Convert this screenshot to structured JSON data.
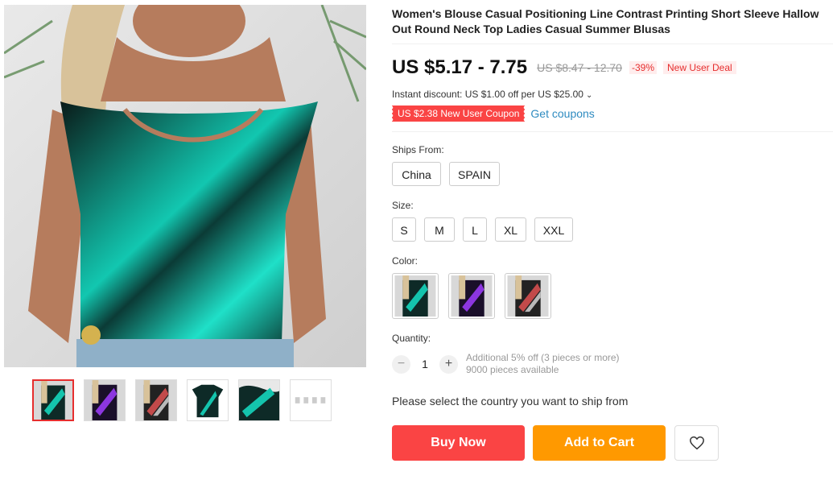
{
  "gallery": {
    "thumbnails": [
      "teal",
      "purple",
      "multicolor",
      "flat-lay",
      "detail",
      "size-chart"
    ]
  },
  "product": {
    "title": "Women's Blouse Casual Positioning Line Contrast Printing Short Sleeve Hallow Out Round Neck Top Ladies Casual Summer Blusas",
    "price": "US $5.17 - 7.75",
    "original_price": "US $8.47 - 12.70",
    "discount": "-39%",
    "deal": "New User Deal",
    "instant_discount": "Instant discount: US $1.00 off per US $25.00",
    "coupon": "US $2.38 New User Coupon",
    "get_coupons": "Get coupons"
  },
  "ships_from": {
    "label": "Ships From:",
    "options": [
      "China",
      "SPAIN"
    ]
  },
  "size": {
    "label": "Size:",
    "options": [
      "S",
      "M",
      "L",
      "XL",
      "XXL"
    ]
  },
  "color": {
    "label": "Color:",
    "options": [
      "teal",
      "purple",
      "multicolor"
    ]
  },
  "quantity": {
    "label": "Quantity:",
    "minus": "−",
    "value": "1",
    "plus": "+",
    "note1": "Additional 5% off (3 pieces or more)",
    "note2": "9000 pieces available"
  },
  "shipping_note": "Please select the country you want to ship from",
  "actions": {
    "buy_now": "Buy Now",
    "add_to_cart": "Add to Cart"
  },
  "colors": {
    "accent_red": "#fa4444",
    "accent_orange": "#ff9900",
    "link_blue": "#2e8bc0"
  }
}
